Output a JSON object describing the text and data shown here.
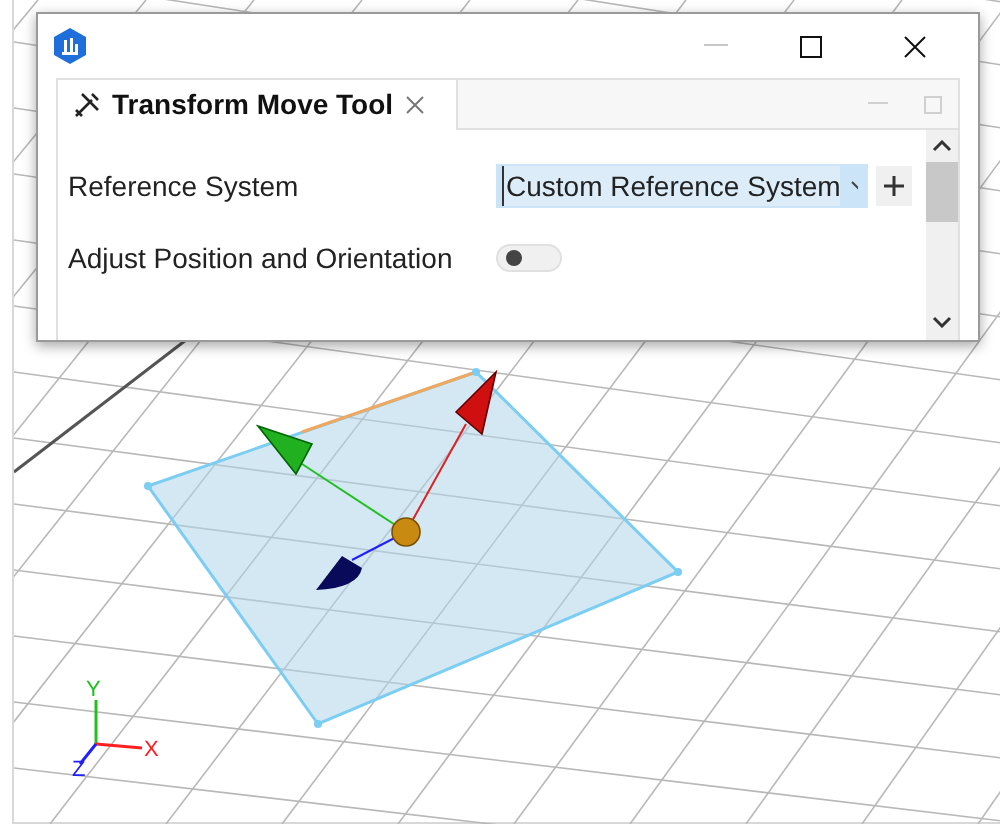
{
  "panel": {
    "tabs": [
      {
        "label": "Transform Move Tool",
        "selected": true
      }
    ],
    "rows": [
      {
        "kind": "combo",
        "label": "Reference System",
        "value": "Custom Reference System"
      },
      {
        "kind": "toggle",
        "label": "Adjust Position and Orientation",
        "on": false
      }
    ]
  },
  "viewport": {
    "axes": [
      {
        "label": "X",
        "color": "#ff2020"
      },
      {
        "label": "Y",
        "color": "#20c020"
      },
      {
        "label": "Z",
        "color": "#2020ff"
      }
    ]
  }
}
